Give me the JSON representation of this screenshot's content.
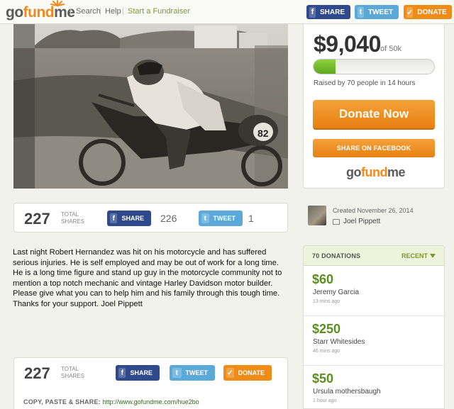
{
  "nav": {
    "logo": {
      "part1": "go",
      "part2": "fund",
      "part3": "me"
    },
    "search": "Search",
    "help": "Help",
    "start": "Start a Fundraiser",
    "share": "SHARE",
    "tweet": "TWEET",
    "donate": "DONATE"
  },
  "campaign": {
    "amount": "$9,040",
    "goal": "of 50k",
    "progress": 0.18,
    "raised": "Raised by 70 people in 14 hours",
    "donate_now": "Donate Now",
    "share_facebook": "SHARE ON FACEBOOK",
    "logo": {
      "part1": "go",
      "part2": "fund",
      "part3": "me"
    }
  },
  "sharebar": {
    "count": "227",
    "label_top": "TOTAL",
    "label_bottom": "SHARES",
    "share": "SHARE",
    "share_count": "226",
    "tweet": "TWEET",
    "tweet_count": "1"
  },
  "creator": {
    "created": "Created November 26, 2014",
    "name": "Joel Pippett"
  },
  "story": "Last night Robert Hernandez was hit on his motorcycle and has suffered serious injuries. He is self employed and may be out of work for a long time. He is a long time figure and stand up guy in the motorcycle community not to mention a top notch mechanic and vintage Harley Davidson motor builder. Please give what you can to help him and his family through this tough time. Thanks for your support. Joel Pippett",
  "donations": {
    "title": "70 DONATIONS",
    "sort": "RECENT",
    "items": [
      {
        "amount": "$60",
        "name": "Jeremy Garcia",
        "time": "13 mins ago"
      },
      {
        "amount": "$250",
        "name": "Starr Whitesides",
        "time": "46 mins ago"
      },
      {
        "amount": "$50",
        "name": "Ursula mothersbaugh",
        "time": "1 hour ago"
      }
    ]
  },
  "bottom": {
    "count": "227",
    "label_top": "TOTAL",
    "label_bottom": "SHARES",
    "share": "SHARE",
    "tweet": "TWEET",
    "donate": "DONATE",
    "copy_label": "COPY, PASTE & SHARE:",
    "url": "http://www.gofundme.com/hue2bo"
  },
  "colors": {
    "facebook": "#2f4a8c",
    "twitter": "#5aa9d8",
    "orange": "#ef8b17",
    "green": "#5a8f1e"
  }
}
